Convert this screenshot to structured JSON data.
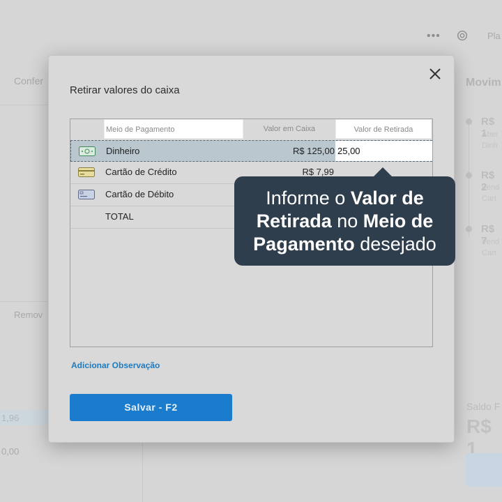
{
  "background": {
    "conferencia_label": "Confer",
    "plan_label": "Pla",
    "movim_label": "Movim",
    "remove_label": "Remov",
    "saldo_label": "Saldo F",
    "saldo_value": "R$ 1",
    "left_value_1": "1,96",
    "left_value_2": "0,00",
    "movements": [
      {
        "amount": "R$ 1",
        "line1": "Aber",
        "line2": "Dinh"
      },
      {
        "amount": "R$ 2",
        "line1": "Vend",
        "line2": "Cart"
      },
      {
        "amount": "R$ 7",
        "line1": "Vend",
        "line2": "Cart"
      }
    ]
  },
  "modal": {
    "title": "Retirar valores do caixa",
    "columns": {
      "meio": "Meio de Pagamento",
      "caixa": "Valor em Caixa",
      "retirada": "Valor de Retirada"
    },
    "rows": [
      {
        "label": "Dinheiro",
        "valor": "R$ 125,00",
        "retirada": "25,00",
        "icon": "cash-icon"
      },
      {
        "label": "Cartão de Crédito",
        "valor": "R$ 7,99",
        "icon": "credit-card-icon"
      },
      {
        "label": "Cartão de Débito",
        "valor": "",
        "icon": "debit-card-icon"
      },
      {
        "label": "TOTAL",
        "valor": ""
      }
    ],
    "add_observation": "Adicionar Observação",
    "save_button": "Salvar - F2"
  },
  "tooltip": {
    "part1": "Informe o ",
    "bold1": "Valor de Retirada",
    "part2": " no ",
    "bold2": "Meio de Pagamento",
    "part3": " desejado"
  },
  "colors": {
    "accent": "#1b7ccd",
    "tooltip_bg": "#2f3e4d",
    "selected_row": "#bac7cf",
    "link": "#1d7bbf"
  }
}
